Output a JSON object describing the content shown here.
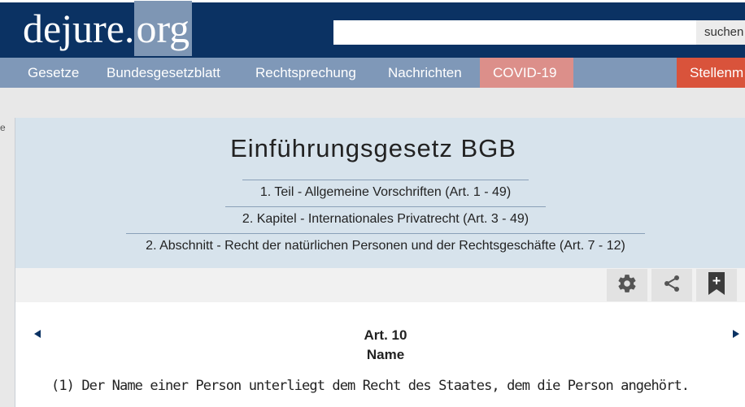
{
  "header": {
    "logo_main": "dejure.",
    "logo_org": "org",
    "search_placeholder": "",
    "search_button": "suchen"
  },
  "nav": {
    "items": [
      "Gesetze",
      "Bundesgesetzblatt",
      "Rechtsprechung",
      "Nachrichten",
      "COVID-19",
      "Stellenm"
    ],
    "colors": {
      "bar": "#7f98b8",
      "covid": "#dc8f8a",
      "jobs": "#d9533b",
      "header": "#0b3263"
    }
  },
  "side": {
    "mark": "e"
  },
  "document": {
    "title": "Einführungsgesetz BGB",
    "breadcrumbs": [
      "1. Teil - Allgemeine Vorschriften (Art. 1 - 49)",
      "2. Kapitel - Internationales Privatrecht (Art. 3 - 49)",
      "2. Abschnitt - Recht der natürlichen Personen und der Rechtsgeschäfte (Art. 7 - 12)"
    ],
    "toolbar_icons": [
      "settings-icon",
      "share-icon",
      "bookmark-add-icon"
    ],
    "article_number": "Art. 10",
    "article_name": "Name",
    "paragraph_1": "(1) Der Name einer Person unterliegt dem Recht des Staates, dem die Person angehört."
  }
}
